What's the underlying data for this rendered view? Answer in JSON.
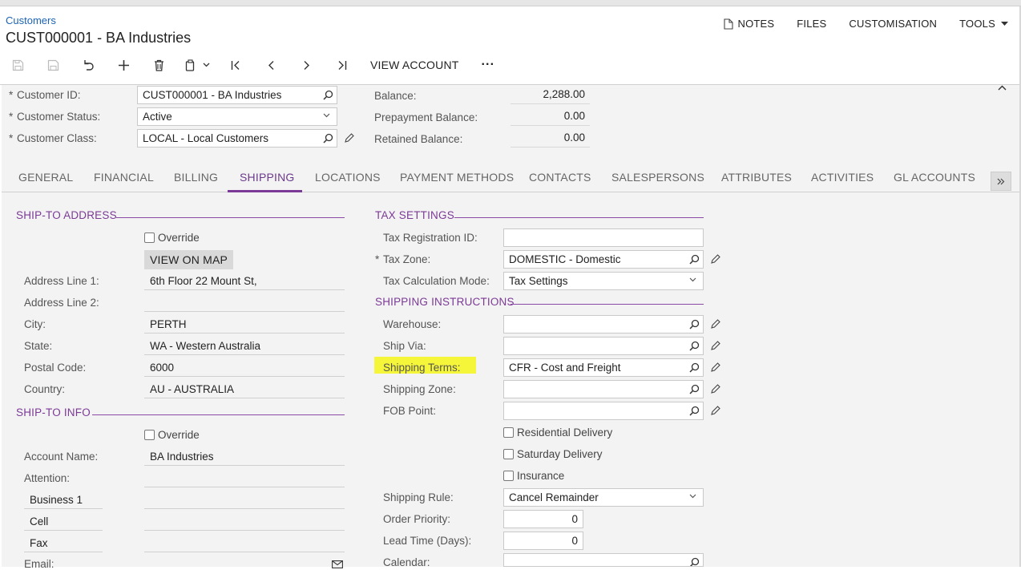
{
  "breadcrumb": "Customers",
  "title": "CUST000001 - BA Industries",
  "header_links": {
    "notes": "NOTES",
    "files": "FILES",
    "customisation": "CUSTOMISATION",
    "tools": "TOOLS"
  },
  "toolbar": {
    "view_account": "VIEW ACCOUNT",
    "more": "···"
  },
  "summary": {
    "customer_id_label": "Customer ID:",
    "customer_id_value": "CUST000001 - BA Industries",
    "customer_status_label": "Customer Status:",
    "customer_status_value": "Active",
    "customer_class_label": "Customer Class:",
    "customer_class_value": "LOCAL - Local Customers",
    "balance_label": "Balance:",
    "balance_value": "2,288.00",
    "prepayment_label": "Prepayment Balance:",
    "prepayment_value": "0.00",
    "retained_label": "Retained Balance:",
    "retained_value": "0.00"
  },
  "tabs": [
    "GENERAL",
    "FINANCIAL",
    "BILLING",
    "SHIPPING",
    "LOCATIONS",
    "PAYMENT METHODS",
    "CONTACTS",
    "SALESPERSONS",
    "ATTRIBUTES",
    "ACTIVITIES",
    "GL ACCOUNTS"
  ],
  "ship_to_address": {
    "title": "SHIP-TO ADDRESS",
    "override": "Override",
    "view_on_map": "VIEW ON MAP",
    "address1_label": "Address Line 1:",
    "address1_value": "6th Floor 22 Mount St,",
    "address2_label": "Address Line 2:",
    "address2_value": "",
    "city_label": "City:",
    "city_value": "PERTH",
    "state_label": "State:",
    "state_value": "WA - Western Australia",
    "postal_label": "Postal Code:",
    "postal_value": "6000",
    "country_label": "Country:",
    "country_value": "AU - AUSTRALIA"
  },
  "ship_to_info": {
    "title": "SHIP-TO INFO",
    "override": "Override",
    "account_name_label": "Account Name:",
    "account_name_value": "BA Industries",
    "attention_label": "Attention:",
    "business1_label": "Business 1",
    "cell_label": "Cell",
    "fax_label": "Fax",
    "email_label": "Email:"
  },
  "tax_settings": {
    "title": "TAX SETTINGS",
    "tax_reg_label": "Tax Registration ID:",
    "tax_reg_value": "",
    "tax_zone_label": "Tax Zone:",
    "tax_zone_value": "DOMESTIC - Domestic",
    "tax_calc_label": "Tax Calculation Mode:",
    "tax_calc_value": "Tax Settings"
  },
  "shipping_instructions": {
    "title": "SHIPPING INSTRUCTIONS",
    "warehouse_label": "Warehouse:",
    "ship_via_label": "Ship Via:",
    "shipping_terms_label": "Shipping Terms:",
    "shipping_terms_value": "CFR - Cost and Freight",
    "shipping_zone_label": "Shipping Zone:",
    "fob_label": "FOB Point:",
    "residential": "Residential Delivery",
    "saturday": "Saturday Delivery",
    "insurance": "Insurance",
    "shipping_rule_label": "Shipping Rule:",
    "shipping_rule_value": "Cancel Remainder",
    "order_priority_label": "Order Priority:",
    "order_priority_value": "0",
    "lead_time_label": "Lead Time (Days):",
    "lead_time_value": "0",
    "calendar_label": "Calendar:"
  },
  "colors": {
    "accent": "#7b3a96",
    "link": "#1b63b3",
    "highlight": "#f5f53a"
  }
}
